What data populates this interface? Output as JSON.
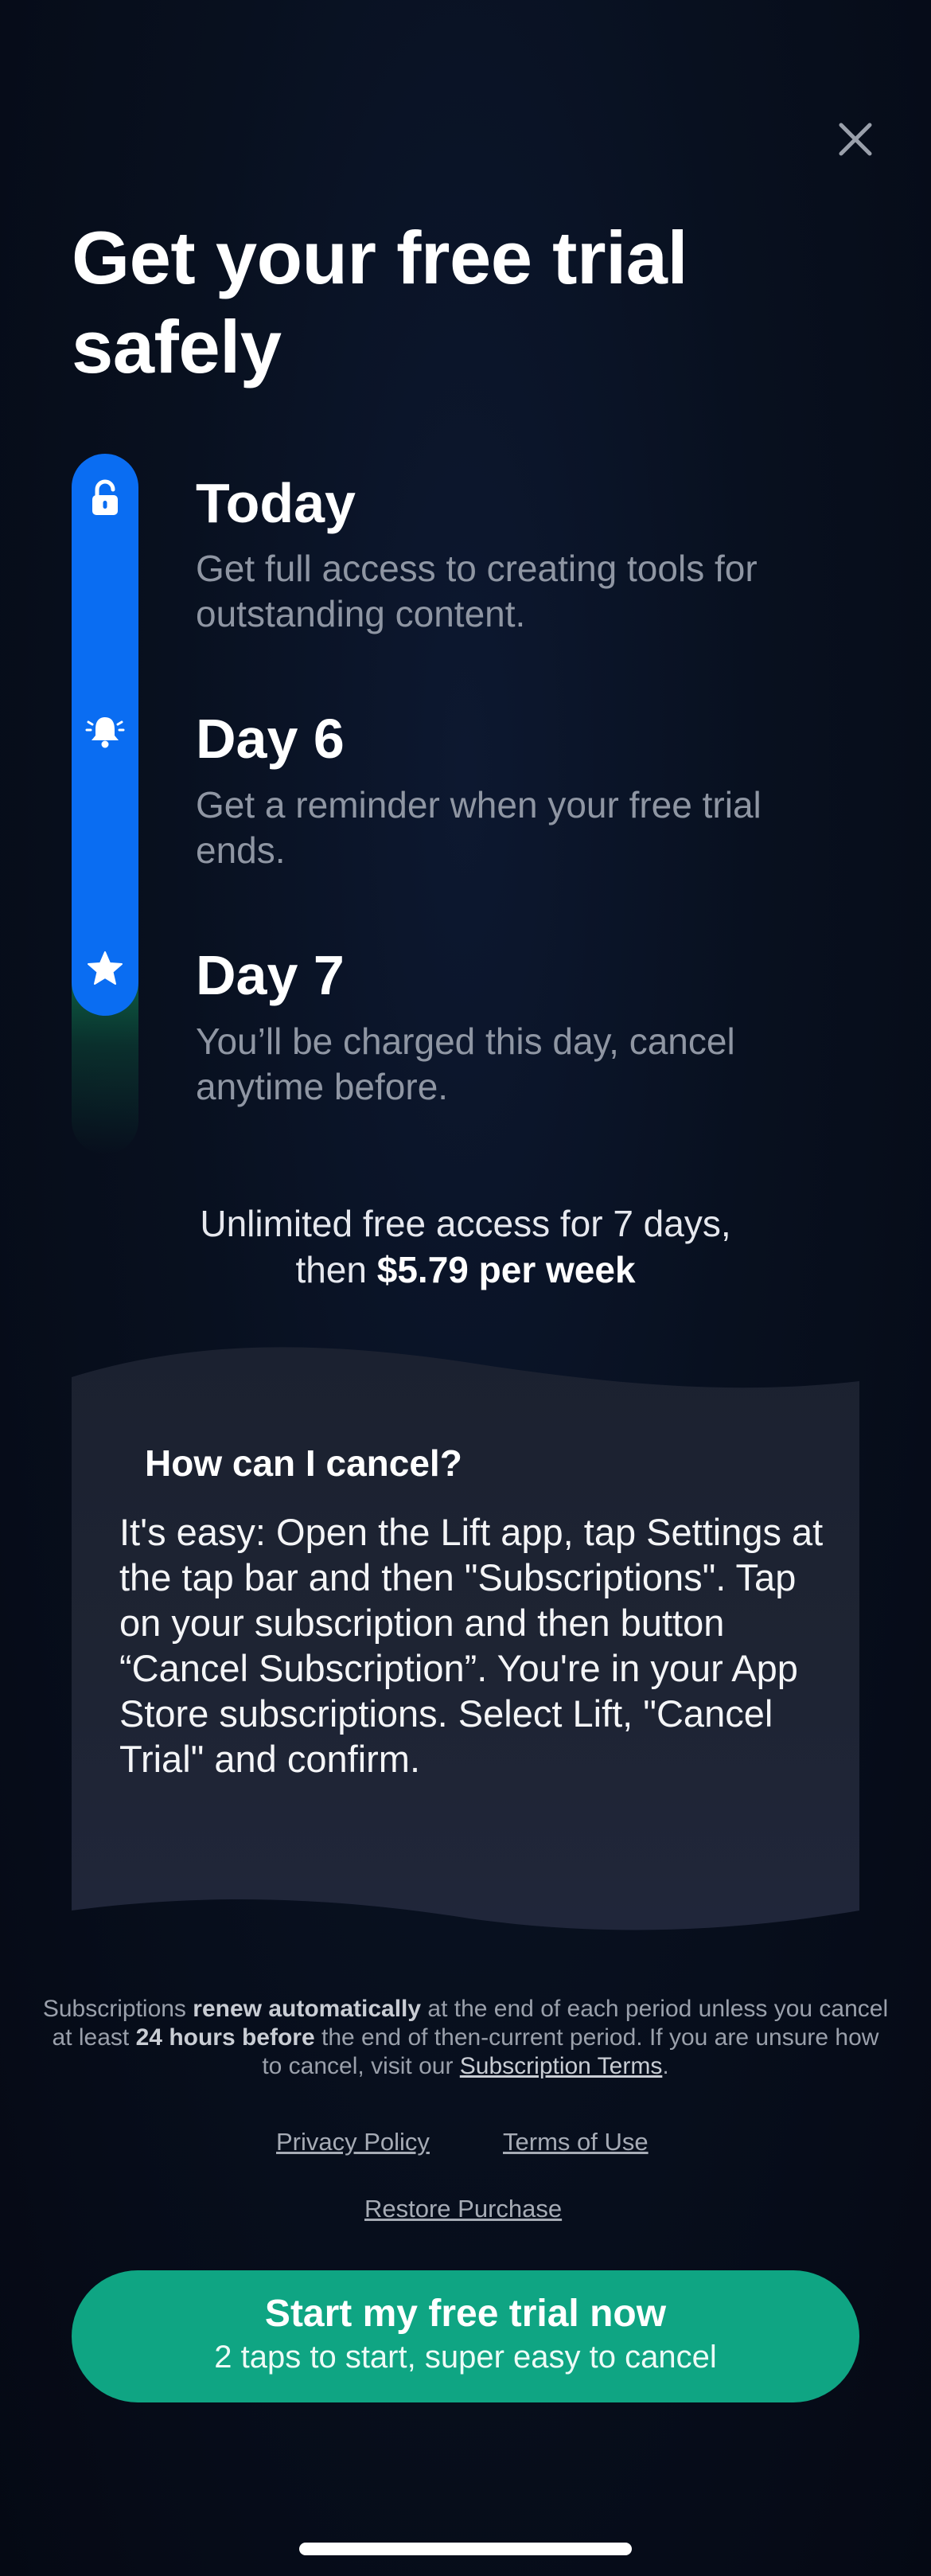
{
  "header": {
    "close_icon": "close-icon",
    "title": "Get your free trial safely"
  },
  "timeline": {
    "steps": [
      {
        "icon": "unlock-icon",
        "title": "Today",
        "description": "Get full access to creating tools for outstanding content."
      },
      {
        "icon": "bell-icon",
        "title": "Day 6",
        "description": "Get a reminder when your free trial ends."
      },
      {
        "icon": "star-icon",
        "title": "Day 7",
        "description": "You’ll be charged this day, cancel anytime before."
      }
    ]
  },
  "offer": {
    "line1": "Unlimited free access for 7 days,",
    "then": "then",
    "price": "$5.79 per week"
  },
  "cancel_card": {
    "title": "How can I cancel?",
    "body": "It's easy: Open the Lift app, tap Settings at the tap bar and then \"Subscriptions\". Tap on your subscription and then button “Cancel Subscription”. You're in your App Store subscriptions. Select Lift, \"Cancel Trial\" and confirm."
  },
  "legal": {
    "part1": "Subscriptions",
    "bold1": "renew automatically",
    "part2": "at the end of each period unless you cancel at least",
    "bold2": "24 hours before",
    "part3": "the end of then-current period. If you are unsure how to cancel, visit our",
    "terms_link": "Subscription Terms",
    "part4": "."
  },
  "links": {
    "privacy": "Privacy Policy",
    "terms": "Terms of Use",
    "restore": "Restore Purchase"
  },
  "cta": {
    "label": "Start my free trial now",
    "sublabel": "2 taps to start, super easy to cancel"
  },
  "colors": {
    "background": "#08101f",
    "accent_blue": "#0a6df2",
    "cta_green": "#0fa583",
    "muted_text": "#8f96a3"
  }
}
